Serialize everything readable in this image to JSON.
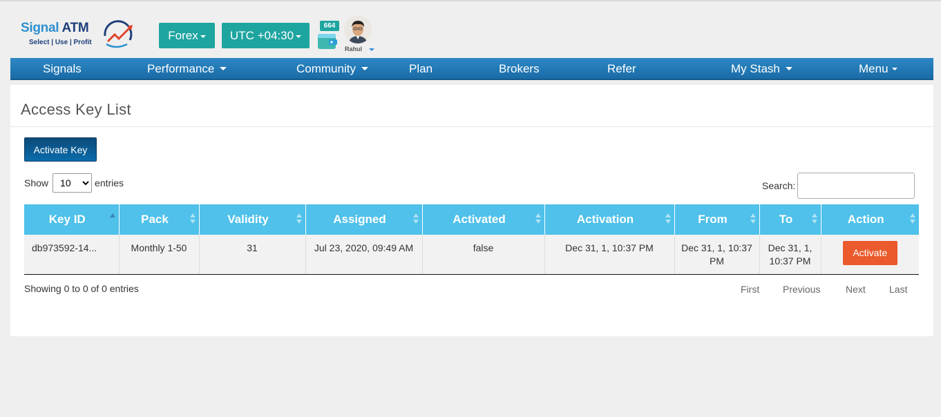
{
  "brand": {
    "name_part1": "Signal",
    "name_part2": "ATM",
    "tagline": "Select | Use | Profit"
  },
  "header": {
    "market_label": "Forex",
    "timezone_label": "UTC +04:30",
    "wallet_count": "664",
    "user_name": "Rahul",
    "accent_color": "#1fa5a0"
  },
  "nav": {
    "items": [
      {
        "label": "Signals"
      },
      {
        "label": "Performance"
      },
      {
        "label": "Community"
      },
      {
        "label": "Plan"
      },
      {
        "label": "Brokers"
      },
      {
        "label": "Refer"
      },
      {
        "label": "My Stash"
      },
      {
        "label": "Menu"
      }
    ]
  },
  "page": {
    "title": "Access Key List",
    "activate_key_label": "Activate Key",
    "length": {
      "prefix": "Show",
      "selected": "10",
      "options": [
        "10"
      ],
      "suffix": "entries"
    },
    "search": {
      "label": "Search:",
      "value": ""
    }
  },
  "table": {
    "columns": [
      "Key ID",
      "Pack",
      "Validity",
      "Assigned",
      "Activated",
      "Activation",
      "From",
      "To",
      "Action"
    ],
    "rows": [
      {
        "key_id": "db973592-14...",
        "pack": "Monthly 1-50",
        "validity": "31",
        "assigned": "Jul 23, 2020, 09:49 AM",
        "activated": "false",
        "activation": "Dec 31, 1, 10:37 PM",
        "from": "Dec 31, 1, 10:37 PM",
        "to": "Dec 31, 1, 10:37 PM",
        "action_label": "Activate"
      }
    ]
  },
  "footer": {
    "info": "Showing 0 to 0 of 0 entries",
    "pager": {
      "first": "First",
      "previous": "Previous",
      "next": "Next",
      "last": "Last"
    }
  }
}
